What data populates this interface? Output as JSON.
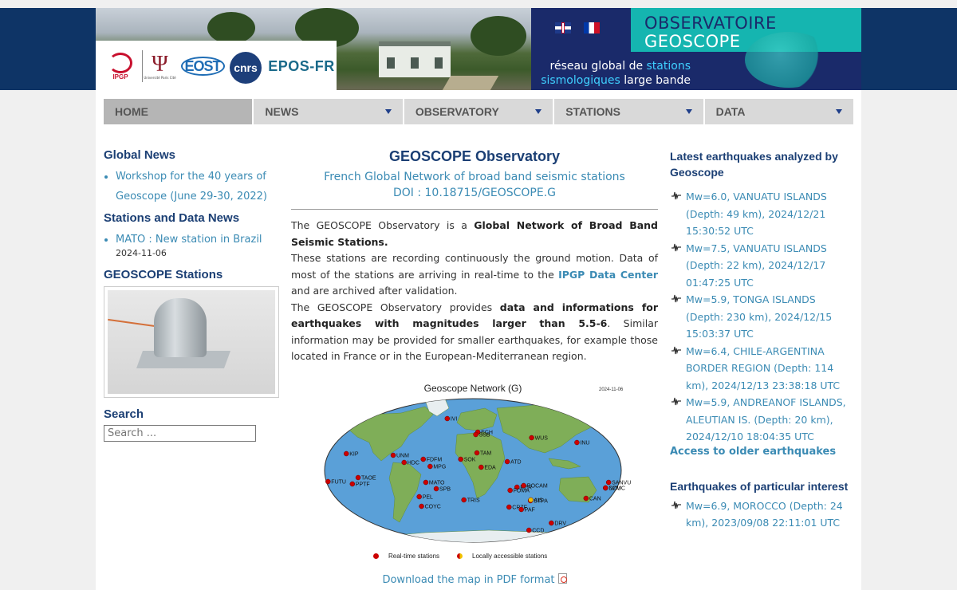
{
  "header": {
    "logos": [
      "IPGP",
      "Université Paris Cité",
      "EOST",
      "cnrs",
      "EPOS-FR"
    ],
    "banner_line1": "OBSERVATOIRE",
    "banner_line2": "GEOSCOPE",
    "tagline_part1": "réseau global de ",
    "tagline_hl1": "stations",
    "tagline_hl2": "sismologiques",
    "tagline_part2": " large bande",
    "flags": [
      "english-flag",
      "french-flag"
    ]
  },
  "nav": {
    "home": "HOME",
    "news": "NEWS",
    "observatory": "OBSERVATORY",
    "stations": "STATIONS",
    "data": "DATA"
  },
  "left": {
    "global_news_title": "Global News",
    "global_news_item": "Workshop for the 40 years of Geoscope (June 29-30, 2022)",
    "stations_news_title": "Stations and Data News",
    "stations_news_item": "MATO : New station in Brazil",
    "stations_news_date": "2024-11-06",
    "geoscope_stations_title": "GEOSCOPE Stations",
    "search_title": "Search",
    "search_placeholder": "Search ..."
  },
  "main": {
    "title": "GEOSCOPE Observatory",
    "subtitle": "French Global Network of broad band seismic stations",
    "doi": "DOI : 10.18715/GEOSCOPE.G",
    "p1_a": "The GEOSCOPE Observatory is a ",
    "p1_b": "Global Network of Broad Band Seismic Stations.",
    "p2_a": "These stations are recording continuously the ground motion. Data of most of the stations are arriving in real-time to the ",
    "p2_link": "IPGP Data Center",
    "p2_b": " and are archived after validation.",
    "p3_a": "The GEOSCOPE Observatory provides ",
    "p3_b": "data and informations for earthquakes with magnitudes larger than 5.5-6",
    "p3_c": ". Similar information may be provided for smaller earthquakes, for example those located in France or in the European-Mediterranean region.",
    "map_title": "Geoscope Network (G)",
    "map_date": "2024-11-06",
    "legend_realtime": "Real-time stations",
    "legend_local": "Locally accessible stations",
    "download": "Download the map in PDF format"
  },
  "map_stations": [
    {
      "code": "IVI",
      "lon": -45,
      "lat": 65,
      "type": "realtime"
    },
    {
      "code": "ECH",
      "lon": 7,
      "lat": 48,
      "type": "realtime"
    },
    {
      "code": "SSB",
      "lon": 4,
      "lat": 45,
      "type": "realtime"
    },
    {
      "code": "WUS",
      "lon": 80,
      "lat": 41,
      "type": "realtime"
    },
    {
      "code": "INU",
      "lon": 137,
      "lat": 35,
      "type": "realtime"
    },
    {
      "code": "KIP",
      "lon": -158,
      "lat": 21,
      "type": "realtime"
    },
    {
      "code": "UNM",
      "lon": -99,
      "lat": 19,
      "type": "realtime"
    },
    {
      "code": "HDC",
      "lon": -84,
      "lat": 10,
      "type": "realtime"
    },
    {
      "code": "FDFM",
      "lon": -61,
      "lat": 14,
      "type": "realtime"
    },
    {
      "code": "MPG",
      "lon": -52,
      "lat": 5,
      "type": "realtime"
    },
    {
      "code": "TAM",
      "lon": 5,
      "lat": 22,
      "type": "realtime"
    },
    {
      "code": "SOK",
      "lon": -15,
      "lat": 14,
      "type": "realtime"
    },
    {
      "code": "EDA",
      "lon": 10,
      "lat": 4,
      "type": "realtime"
    },
    {
      "code": "ATD",
      "lon": 42,
      "lat": 11,
      "type": "realtime"
    },
    {
      "code": "TAOE",
      "lon": -140,
      "lat": -9,
      "type": "realtime"
    },
    {
      "code": "PPTF",
      "lon": -149,
      "lat": -17,
      "type": "realtime"
    },
    {
      "code": "MATO",
      "lon": -58,
      "lat": -15,
      "type": "realtime"
    },
    {
      "code": "SPB",
      "lon": -46,
      "lat": -23,
      "type": "realtime"
    },
    {
      "code": "PEL",
      "lon": -70,
      "lat": -33,
      "type": "realtime"
    },
    {
      "code": "COYC",
      "lon": -72,
      "lat": -45,
      "type": "realtime"
    },
    {
      "code": "TRIS",
      "lon": -12,
      "lat": -37,
      "type": "realtime"
    },
    {
      "code": "RER",
      "lon": 55,
      "lat": -21,
      "type": "realtime"
    },
    {
      "code": "ROCAM",
      "lon": 63,
      "lat": -19,
      "type": "realtime"
    },
    {
      "code": "FOMA",
      "lon": 47,
      "lat": -25,
      "type": "realtime"
    },
    {
      "code": "CRZF",
      "lon": 51,
      "lat": -46,
      "type": "realtime"
    },
    {
      "code": "STPA",
      "lon": 77,
      "lat": -38,
      "type": "realtime"
    },
    {
      "code": "AIS",
      "lon": 77,
      "lat": -37,
      "type": "local"
    },
    {
      "code": "PAF",
      "lon": 70,
      "lat": -49,
      "type": "realtime"
    },
    {
      "code": "SANVU",
      "lon": 167,
      "lat": -15,
      "type": "realtime"
    },
    {
      "code": "FUTU",
      "lon": -178,
      "lat": -14,
      "type": "realtime"
    },
    {
      "code": "NOUC",
      "lon": 166,
      "lat": -22,
      "type": "realtime"
    },
    {
      "code": "DZM",
      "lon": 166,
      "lat": -22,
      "type": "realtime"
    },
    {
      "code": "CAN",
      "lon": 149,
      "lat": -35,
      "type": "realtime"
    },
    {
      "code": "DRV",
      "lon": 140,
      "lat": -66,
      "type": "realtime"
    },
    {
      "code": "CCD",
      "lon": 123,
      "lat": -75,
      "type": "realtime"
    }
  ],
  "right": {
    "latest_title": "Latest earthquakes analyzed by Geoscope",
    "latest": [
      "Mw=6.0, VANUATU ISLANDS (Depth: 49 km), 2024/12/21 15:30:52 UTC",
      "Mw=7.5, VANUATU ISLANDS (Depth: 22 km), 2024/12/17 01:47:25 UTC",
      "Mw=5.9, TONGA ISLANDS (Depth: 230 km), 2024/12/15 15:03:37 UTC",
      "Mw=6.4, CHILE-ARGENTINA BORDER REGION (Depth: 114 km), 2024/12/13 23:38:18 UTC",
      "Mw=5.9, ANDREANOF ISLANDS, ALEUTIAN IS. (Depth: 20 km), 2024/12/10 18:04:35 UTC"
    ],
    "older": "Access to older earthquakes",
    "particular_title": "Earthquakes of particular interest",
    "particular": [
      "Mw=6.9, MOROCCO (Depth: 24 km), 2023/09/08 22:11:01 UTC"
    ]
  },
  "colors": {
    "nav_bg": "#d9d9d9",
    "heading": "#1b3f74",
    "link": "#3b8bb4",
    "banner_teal": "#15b5b0",
    "header_band": "#0e3466",
    "station_realtime": "#cc0000",
    "station_local": "#f2c200"
  }
}
